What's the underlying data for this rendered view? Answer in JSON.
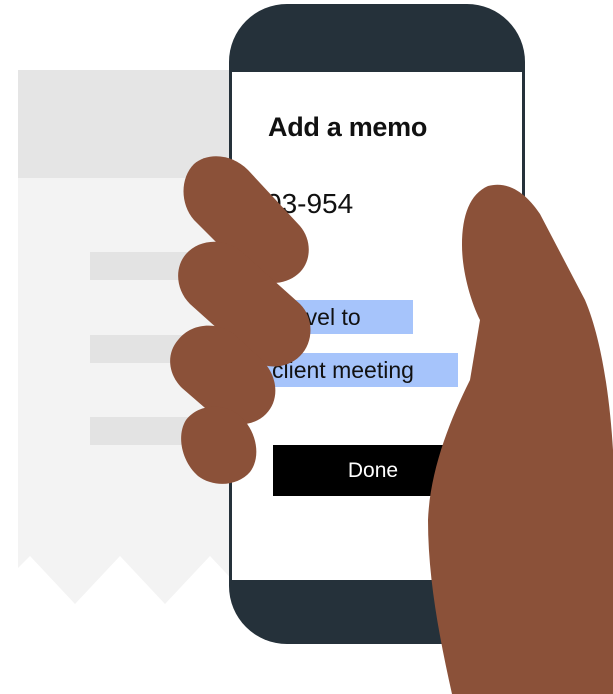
{
  "memo": {
    "title": "Add a memo",
    "code": "03-954",
    "line1": "Travel to",
    "line2": "client meeting",
    "done_label": "Done"
  },
  "colors": {
    "phone_frame": "#25313a",
    "highlight": "#a6c4fb",
    "skin": "#8b5139",
    "receipt": "#f3f3f3",
    "receipt_band": "#e5e5e5",
    "button": "#000000"
  }
}
